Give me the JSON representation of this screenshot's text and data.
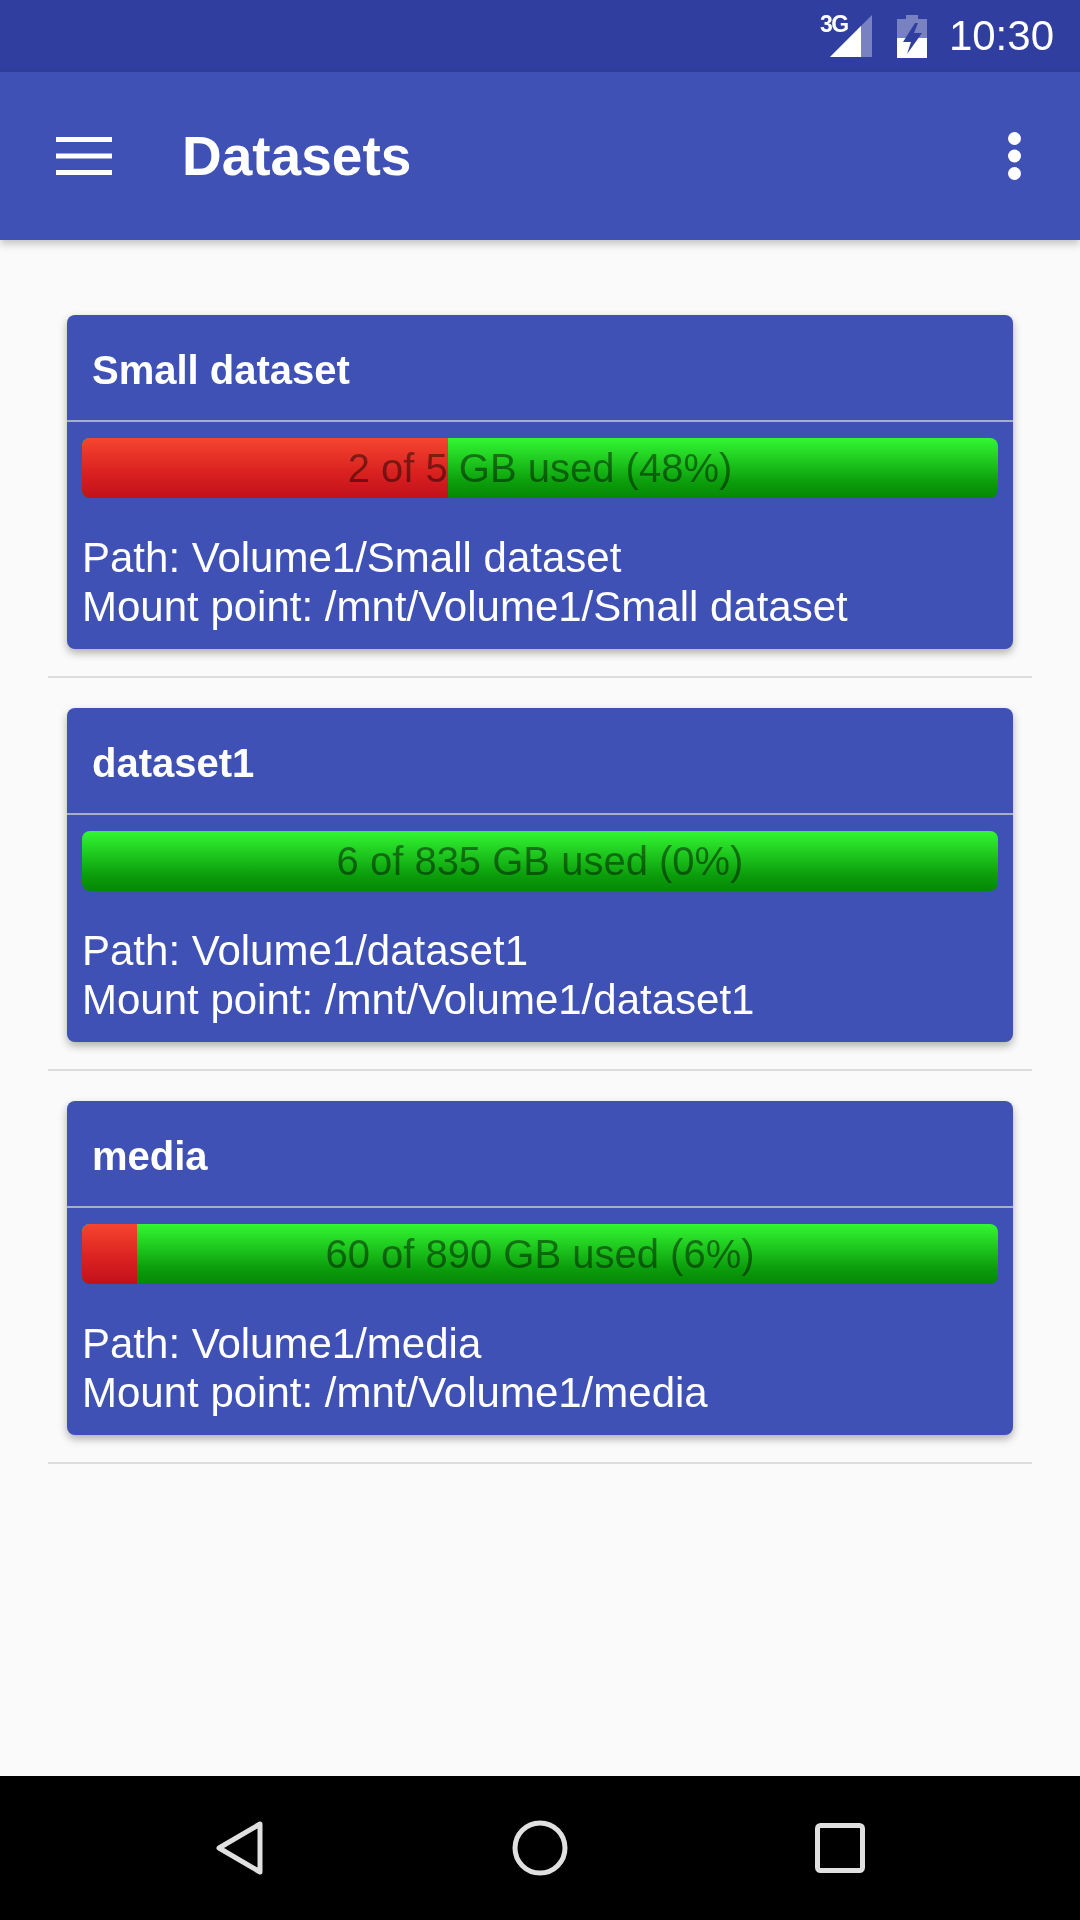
{
  "status_bar": {
    "network": "3G",
    "time": "10:30"
  },
  "app_bar": {
    "title": "Datasets"
  },
  "datasets": [
    {
      "name": "Small dataset",
      "usage": "2 of 5 GB used (48%)",
      "level": 0.4,
      "path": "Path: Volume1/Small dataset",
      "mount_point": "Mount point: /mnt/Volume1/Small dataset"
    },
    {
      "name": "dataset1",
      "usage": "6 of 835 GB used (0%)",
      "path": "Path: Volume1/dataset1",
      "mount_point": "Mount point: /mnt/Volume1/dataset1"
    },
    {
      "name": "media",
      "usage": "60 of 890 GB used (6%)",
      "level": 0.06,
      "path": "Path: Volume1/media",
      "mount_point": "Mount point: /mnt/Volume1/media"
    }
  ]
}
